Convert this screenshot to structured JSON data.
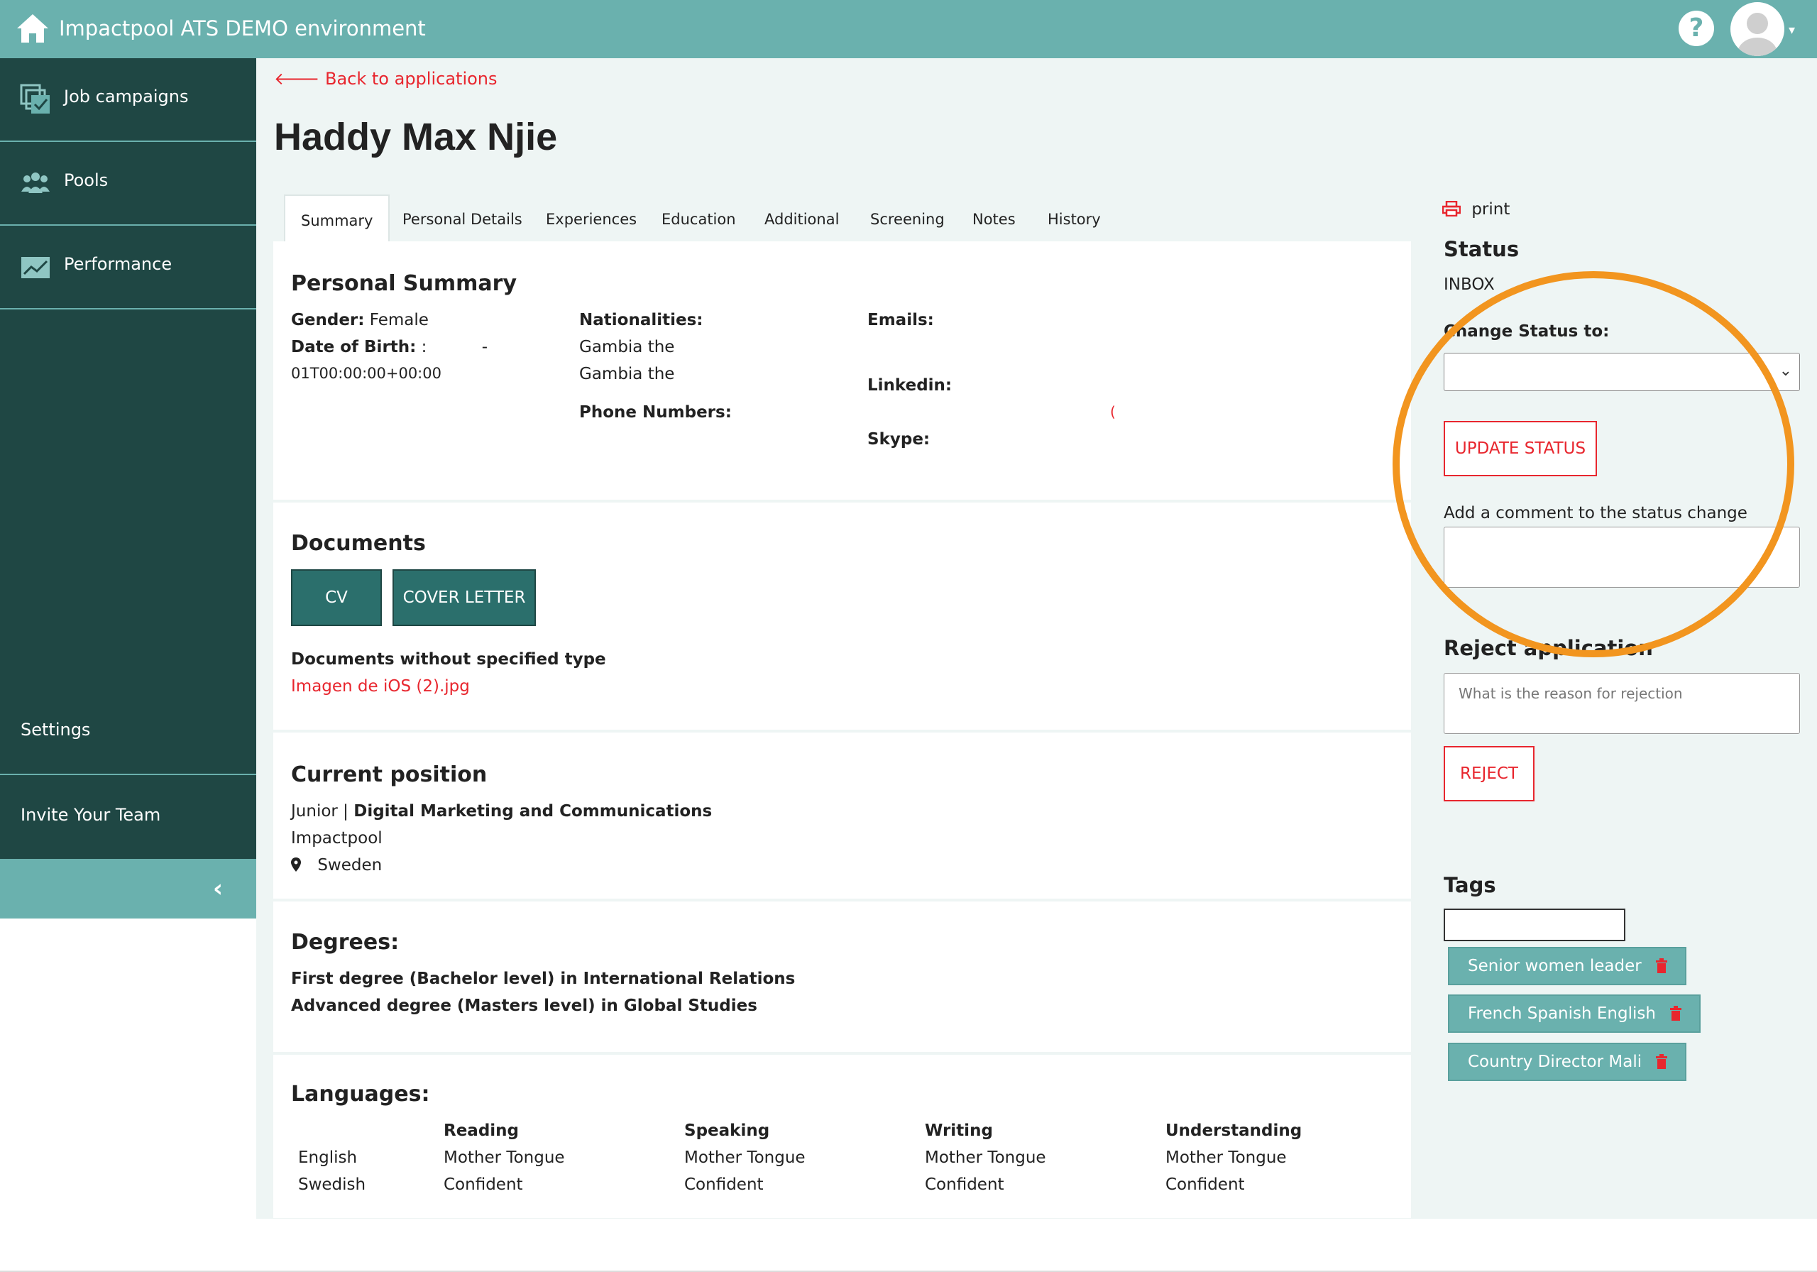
{
  "header": {
    "app_title": "Impactpool ATS DEMO environment",
    "help_label": "?"
  },
  "sidebar": {
    "items": [
      {
        "label": "Job campaigns",
        "icon": "campaigns-icon"
      },
      {
        "label": "Pools",
        "icon": "users-icon"
      },
      {
        "label": "Performance",
        "icon": "chart-icon"
      }
    ],
    "settings_label": "Settings",
    "invite_label": "Invite Your Team"
  },
  "main": {
    "back_label": "Back to applications",
    "candidate_name": "Haddy Max Njie",
    "tabs": [
      "Summary",
      "Personal Details",
      "Experiences",
      "Education",
      "Additional",
      "Screening",
      "Notes",
      "History"
    ],
    "active_tab": "Summary",
    "personal_summary": {
      "title": "Personal Summary",
      "gender_label": "Gender:",
      "gender_value": "Female",
      "dob_label": "Date of Birth:",
      "dob_value_line1": ":",
      "dob_value_line1_suffix": "-",
      "dob_value_line2": "01T00:00:00+00:00",
      "nationalities_label": "Nationalities:",
      "nationalities": [
        "Gambia the",
        "Gambia the"
      ],
      "phone_label": "Phone Numbers:",
      "emails_label": "Emails:",
      "linkedin_label": "Linkedin:",
      "linkedin_value": "(",
      "skype_label": "Skype:"
    },
    "documents": {
      "title": "Documents",
      "buttons": [
        "CV",
        "COVER LETTER"
      ],
      "unspecified_label": "Documents without specified type",
      "file_link": "Imagen de iOS (2).jpg"
    },
    "current_position": {
      "title": "Current position",
      "level": "Junior |",
      "role": "Digital Marketing and Communications",
      "company": "Impactpool",
      "location": "Sweden"
    },
    "degrees": {
      "title": "Degrees:",
      "items": [
        "First degree (Bachelor level) in International Relations",
        "Advanced degree (Masters level) in Global Studies"
      ]
    },
    "languages": {
      "title": "Languages:",
      "columns": [
        "Reading",
        "Speaking",
        "Writing",
        "Understanding"
      ],
      "rows": [
        {
          "language": "English",
          "values": [
            "Mother Tongue",
            "Mother Tongue",
            "Mother Tongue",
            "Mother Tongue"
          ]
        },
        {
          "language": "Swedish",
          "values": [
            "Confident",
            "Confident",
            "Confident",
            "Confident"
          ]
        }
      ]
    }
  },
  "right": {
    "print_label": "print",
    "status_title": "Status",
    "status_value": "INBOX",
    "change_status_label": "Change Status to:",
    "update_status_button": "UPDATE STATUS",
    "comment_label": "Add a comment to the status change",
    "reject_title": "Reject application",
    "reject_placeholder": "What is the reason for rejection",
    "reject_button": "REJECT",
    "tags_title": "Tags",
    "tags": [
      "Senior women leader",
      "French Spanish English",
      "Country Director Mali"
    ]
  },
  "colors": {
    "brand_teal": "#6ab1ae",
    "sidebar_dark": "#1f4744",
    "accent_red": "#e8262e",
    "highlight_orange": "#f2951f"
  }
}
